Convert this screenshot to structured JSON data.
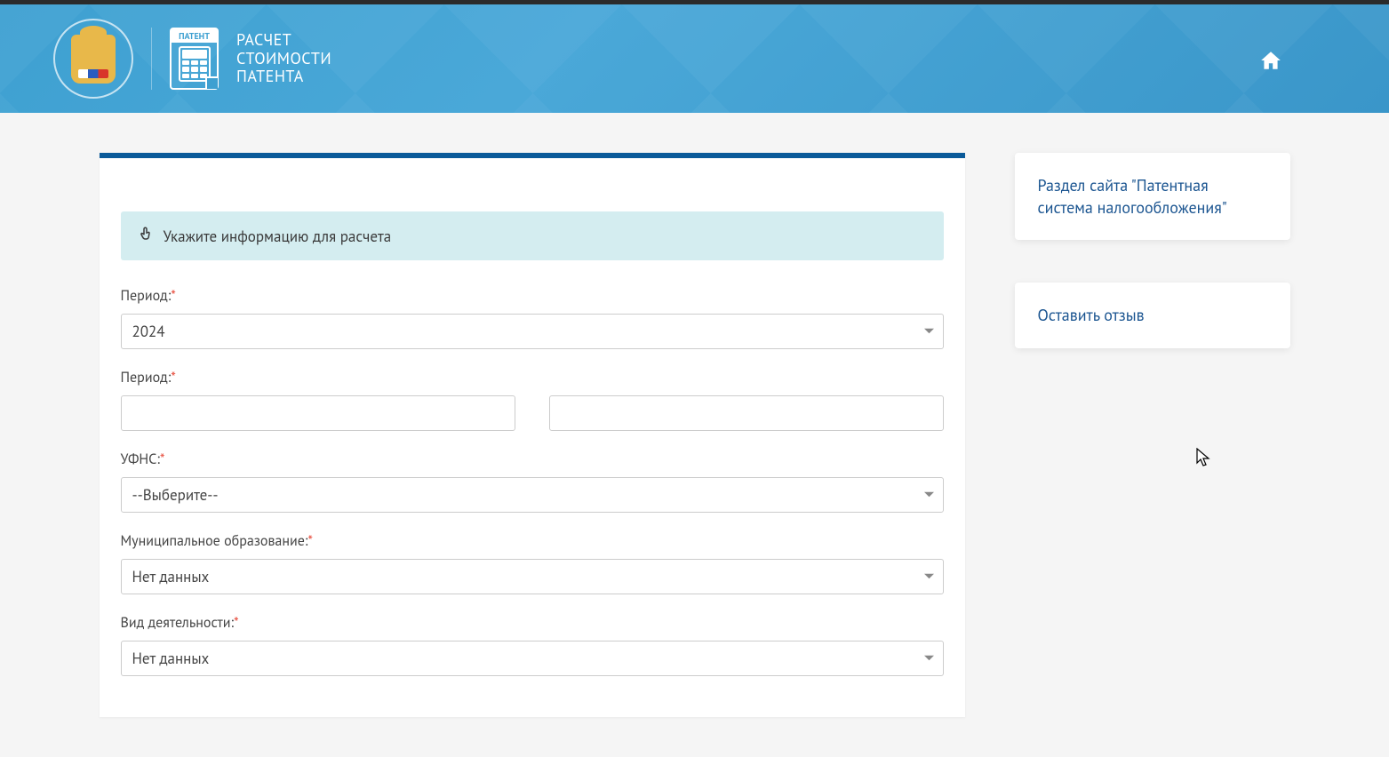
{
  "header": {
    "badge_label": "ПАТЕНТ",
    "title_line1": "РАСЧЕТ",
    "title_line2": "СТОИМОСТИ",
    "title_line3": "ПАТЕНТА"
  },
  "form": {
    "banner": "Укажите информацию для расчета",
    "period_year": {
      "label": "Период:",
      "value": "2024"
    },
    "period_range": {
      "label": "Период:",
      "from": "",
      "to": ""
    },
    "ufns": {
      "label": "УФНС:",
      "value": "--Выберите--"
    },
    "municipality": {
      "label": "Муниципальное образование:",
      "value": "Нет данных"
    },
    "activity": {
      "label": "Вид деятельности:",
      "value": "Нет данных"
    }
  },
  "sidebar": {
    "link1": "Раздел сайта \"Патентная система налогообложения\"",
    "link2": "Оставить отзыв"
  }
}
